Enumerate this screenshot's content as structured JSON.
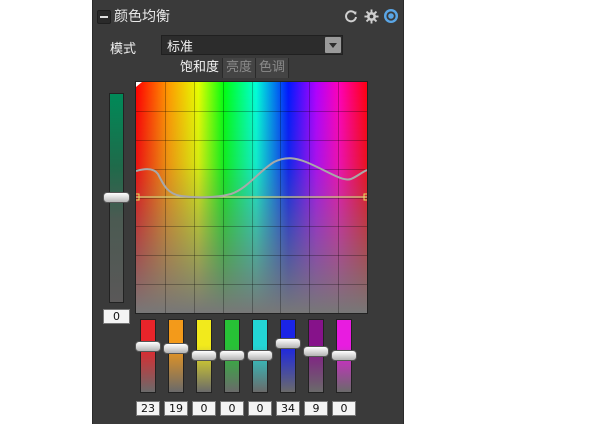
{
  "panel": {
    "title": "颜色均衡",
    "icons": [
      "refresh-icon",
      "gear-icon",
      "target-icon"
    ]
  },
  "mode": {
    "label": "模式",
    "value": "标准"
  },
  "tabs": [
    {
      "label": "饱和度",
      "active": true
    },
    {
      "label": "亮度",
      "active": false
    },
    {
      "label": "色调",
      "active": false
    }
  ],
  "master": {
    "value": "0",
    "level": 0.5
  },
  "channels": [
    {
      "color": "#e8242a",
      "value": "23",
      "level": 0.62
    },
    {
      "color": "#f39a1a",
      "value": "19",
      "level": 0.6
    },
    {
      "color": "#f2ea1c",
      "value": "0",
      "level": 0.5
    },
    {
      "color": "#27c136",
      "value": "0",
      "level": 0.5
    },
    {
      "color": "#23d6d6",
      "value": "0",
      "level": 0.5
    },
    {
      "color": "#1a24e6",
      "value": "34",
      "level": 0.67
    },
    {
      "color": "#86128a",
      "value": "9",
      "level": 0.55
    },
    {
      "color": "#e81ce0",
      "value": "0",
      "level": 0.5
    }
  ],
  "colors": {
    "panel_bg": "#3a3a3a",
    "curve": "#9a9a9a",
    "baseline": "#c8c86a"
  }
}
